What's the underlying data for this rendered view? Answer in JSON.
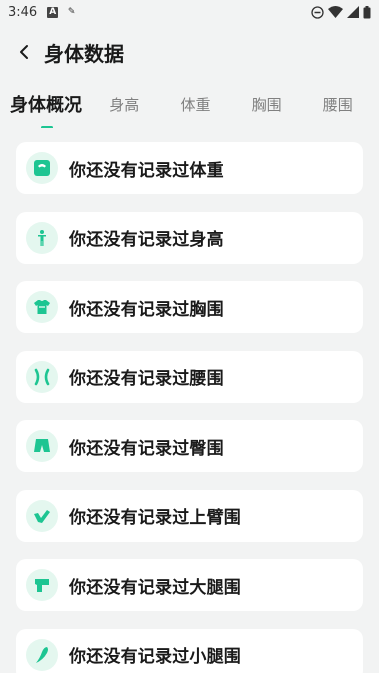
{
  "status_bar": {
    "time": "3:46",
    "icons": [
      "notification-a-icon",
      "pen-icon",
      "dnd-icon",
      "wifi-icon",
      "signal-icon",
      "battery-icon"
    ]
  },
  "header": {
    "title": "身体数据",
    "back_icon": "chevron-left-icon"
  },
  "tabs": [
    {
      "label": "身体概况",
      "active": true
    },
    {
      "label": "身高",
      "active": false
    },
    {
      "label": "体重",
      "active": false
    },
    {
      "label": "胸围",
      "active": false
    },
    {
      "label": "腰围",
      "active": false
    }
  ],
  "colors": {
    "accent": "#1dc592",
    "icon_bg": "#e4f7ef",
    "page_bg": "#f2f3f3",
    "card_bg": "#ffffff"
  },
  "records": [
    {
      "text": "你还没有记录过体重",
      "icon": "scale-icon"
    },
    {
      "text": "你还没有记录过身高",
      "icon": "person-standing-icon"
    },
    {
      "text": "你还没有记录过胸围",
      "icon": "shirt-icon"
    },
    {
      "text": "你还没有记录过腰围",
      "icon": "waist-icon"
    },
    {
      "text": "你还没有记录过臀围",
      "icon": "shorts-icon"
    },
    {
      "text": "你还没有记录过上臂围",
      "icon": "arm-icon"
    },
    {
      "text": "你还没有记录过大腿围",
      "icon": "thigh-icon"
    },
    {
      "text": "你还没有记录过小腿围",
      "icon": "calf-icon"
    }
  ]
}
